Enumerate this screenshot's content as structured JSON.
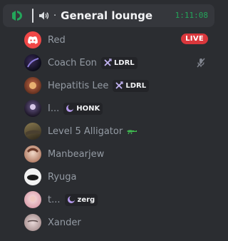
{
  "header": {
    "channel_name": "General lounge",
    "separator_dot": "·",
    "elapsed_time": "1:11:08"
  },
  "participants": [
    {
      "name": "Red",
      "status": "LIVE"
    },
    {
      "name": "Coach Eon",
      "tag": "LDRL",
      "muted": true
    },
    {
      "name": "Hepatitis Lee",
      "tag": "LDRL"
    },
    {
      "name": "I...",
      "tag": "HONK"
    },
    {
      "name": "Level 5 Alligator",
      "badge_icon": "crocodile-icon"
    },
    {
      "name": "Manbearjew"
    },
    {
      "name": "Ryuga"
    },
    {
      "name": "t...",
      "tag": "zerg"
    },
    {
      "name": "Xander"
    }
  ],
  "colors": {
    "background": "#2b2d31",
    "header_background": "#35373c",
    "timer_green": "#23a55a",
    "live_red": "#da373c",
    "discord_blurple": "#f04747"
  }
}
